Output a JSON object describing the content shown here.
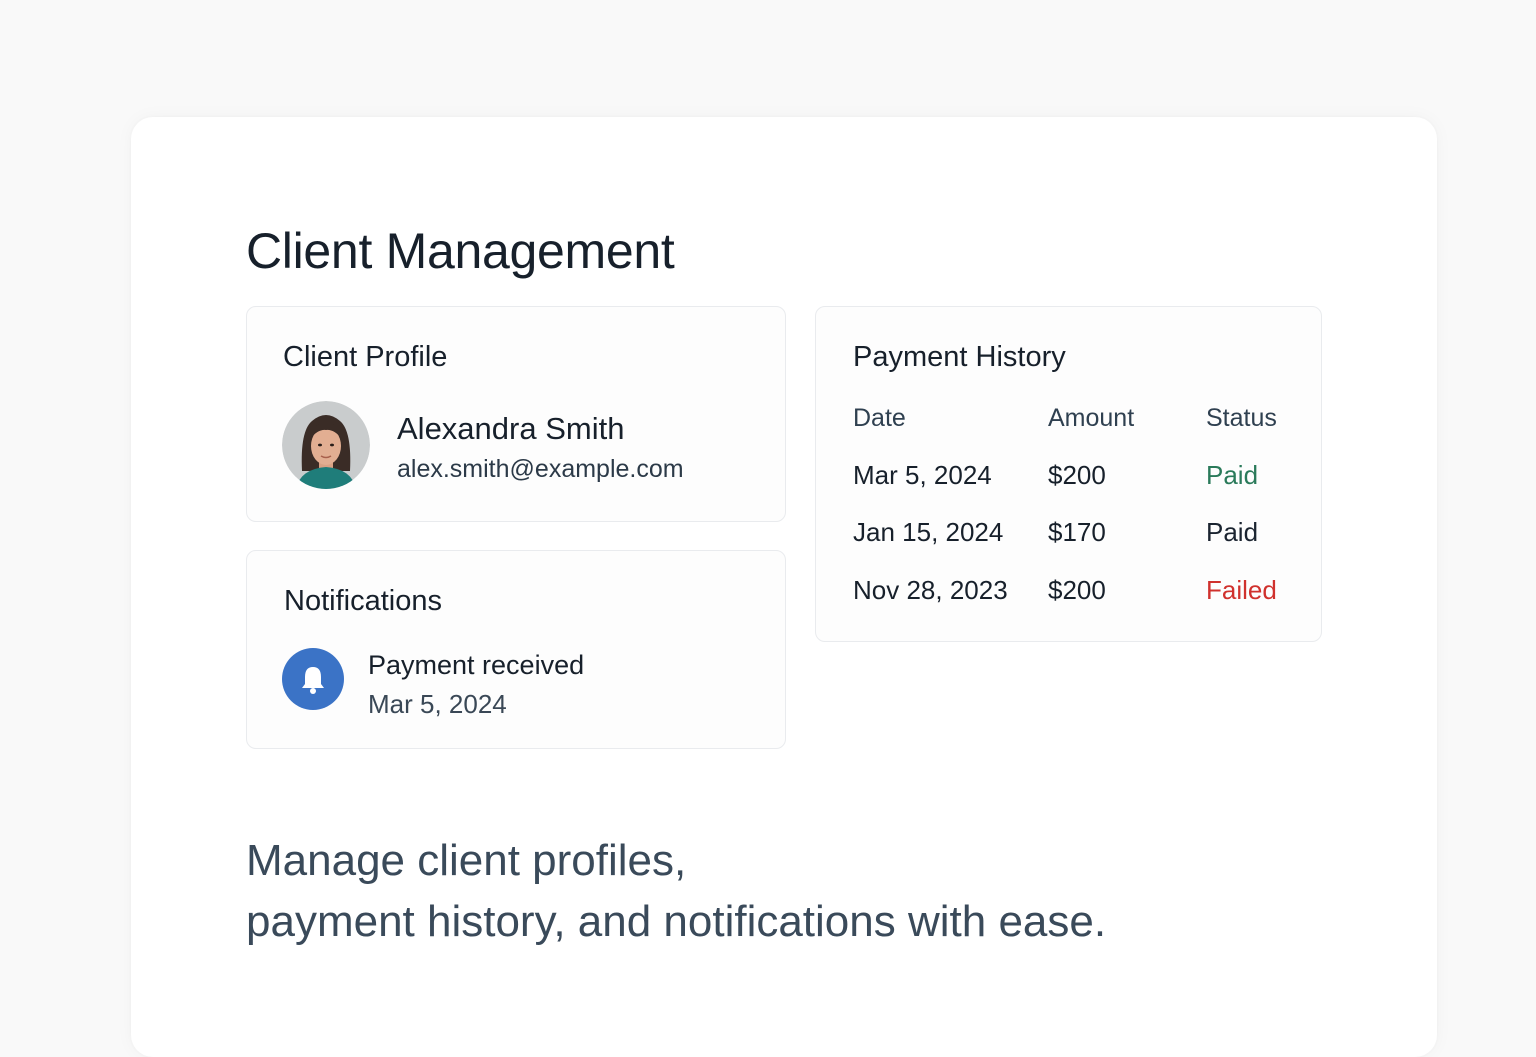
{
  "page": {
    "title": "Client Management",
    "tagline_line1": "Manage client profiles,",
    "tagline_line2": "payment history, and notifications with ease."
  },
  "profile": {
    "title": "Client Profile",
    "name": "Alexandra Smith",
    "email": "alex.smith@example.com",
    "avatar_icon": "avatar-portrait"
  },
  "notifications": {
    "title": "Notifications",
    "icon": "bell-icon",
    "items": [
      {
        "text": "Payment received",
        "date": "Mar 5, 2024"
      }
    ]
  },
  "payments": {
    "title": "Payment History",
    "headers": {
      "date": "Date",
      "amount": "Amount",
      "status": "Status"
    },
    "rows": [
      {
        "date": "Mar 5, 2024",
        "amount": "$200",
        "status": "Paid",
        "status_color": "#2a7a5a"
      },
      {
        "date": "Jan 15, 2024",
        "amount": "$170",
        "status": "Paid",
        "status_color": "#1b2430"
      },
      {
        "date": "Nov 28, 2023",
        "amount": "$200",
        "status": "Failed",
        "status_color": "#d0312d"
      }
    ]
  },
  "colors": {
    "accent": "#3b73c6",
    "paid": "#2a7a5a",
    "failed": "#d0312d"
  }
}
